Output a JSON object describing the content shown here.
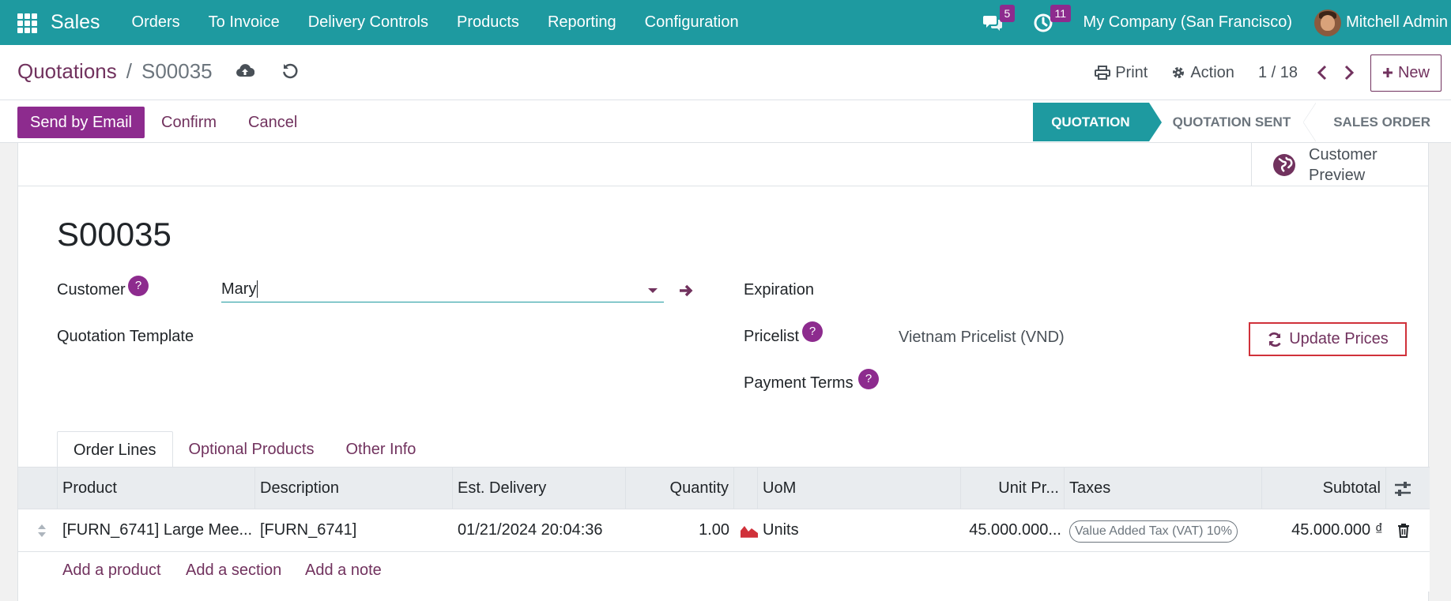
{
  "navbar": {
    "brand": "Sales",
    "menu": [
      "Orders",
      "To Invoice",
      "Delivery Controls",
      "Products",
      "Reporting",
      "Configuration"
    ],
    "messages_count": "5",
    "activities_count": "11",
    "company": "My Company (San Francisco)",
    "user": "Mitchell Admin"
  },
  "control": {
    "breadcrumb_parent": "Quotations",
    "breadcrumb_current": "S00035",
    "print_label": "Print",
    "action_label": "Action",
    "pager": "1 / 18",
    "new_label": "New"
  },
  "statusbar": {
    "send_email": "Send by Email",
    "confirm": "Confirm",
    "cancel": "Cancel",
    "steps": [
      "QUOTATION",
      "QUOTATION SENT",
      "SALES ORDER"
    ],
    "active_step": "QUOTATION"
  },
  "sheet": {
    "customer_preview": "Customer Preview",
    "record_name": "S00035",
    "fields": {
      "customer_label": "Customer",
      "customer_value": "Mary",
      "quotation_template_label": "Quotation Template",
      "expiration_label": "Expiration",
      "pricelist_label": "Pricelist",
      "pricelist_value": "Vietnam Pricelist (VND)",
      "payment_terms_label": "Payment Terms",
      "help_mark": "?",
      "update_prices": "Update Prices"
    },
    "tabs": [
      "Order Lines",
      "Optional Products",
      "Other Info"
    ],
    "table": {
      "headers": {
        "product": "Product",
        "description": "Description",
        "est_delivery": "Est. Delivery",
        "quantity": "Quantity",
        "uom": "UoM",
        "unit_price": "Unit Pr...",
        "taxes": "Taxes",
        "subtotal": "Subtotal"
      },
      "rows": [
        {
          "product": "[FURN_6741] Large Mee...",
          "description": "[FURN_6741]",
          "est_delivery": "01/21/2024 20:04:36",
          "quantity": "1.00",
          "uom": "Units",
          "unit_price": "45.000.000...",
          "taxes": "Value Added Tax (VAT) 10%",
          "subtotal": "45.000.000 ₫"
        }
      ],
      "add_links": [
        "Add a product",
        "Add a section",
        "Add a note"
      ]
    }
  },
  "colors": {
    "navbar": "#1e9aa0",
    "primary": "#8d2b8e",
    "link": "#71325e",
    "highlight_border": "#d0313a"
  }
}
